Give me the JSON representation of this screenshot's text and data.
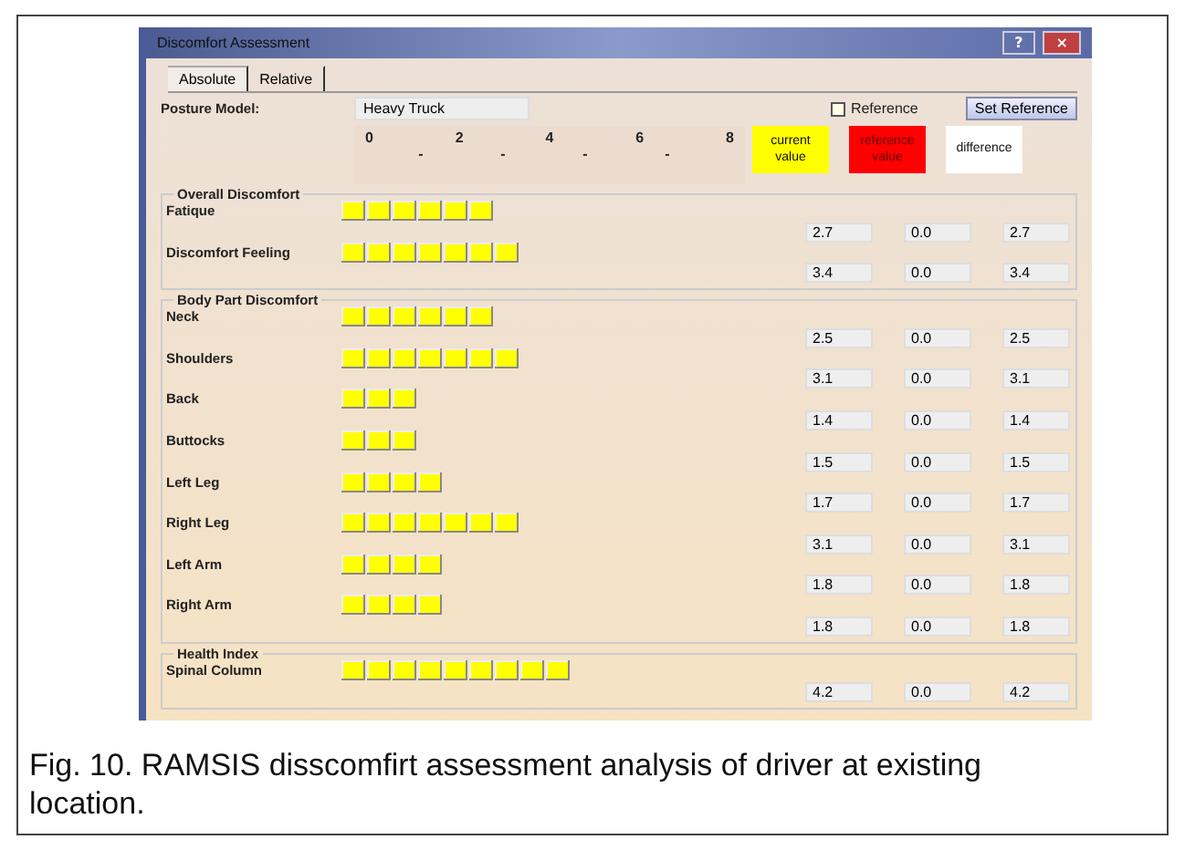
{
  "window": {
    "title": "Discomfort Assessment",
    "buttons": [
      "?",
      "×"
    ]
  },
  "tabs": [
    {
      "label": "Absolute",
      "selected": true
    },
    {
      "label": "Relative",
      "selected": false
    }
  ],
  "posture_model": {
    "label": "Posture Model:",
    "value": "Heavy Truck"
  },
  "reference": {
    "label": "Reference",
    "checked": false
  },
  "set_reference_button": "Set Reference",
  "scale": {
    "labels": [
      "0",
      "2",
      "4",
      "6",
      "8"
    ],
    "marks": [
      "-",
      "-",
      "-",
      "-"
    ]
  },
  "legend": [
    {
      "label": "current value",
      "color": "#ffff00"
    },
    {
      "label": "reference value",
      "color": "#ff0000"
    },
    {
      "label": "difference",
      "color": "#ffffff"
    }
  ],
  "groups": [
    {
      "title": "Overall Discomfort",
      "rows": [
        {
          "name": "Fatique",
          "stars": 6,
          "current": "2.7",
          "reference": "0.0",
          "difference": "2.7"
        },
        {
          "name": "Discomfort Feeling",
          "stars": 7,
          "current": "3.4",
          "reference": "0.0",
          "difference": "3.4"
        }
      ]
    },
    {
      "title": "Body Part Discomfort",
      "rows": [
        {
          "name": "Neck",
          "stars": 6,
          "current": "2.5",
          "reference": "0.0",
          "difference": "2.5"
        },
        {
          "name": "Shoulders",
          "stars": 7,
          "current": "3.1",
          "reference": "0.0",
          "difference": "3.1"
        },
        {
          "name": "Back",
          "stars": 3,
          "current": "1.4",
          "reference": "0.0",
          "difference": "1.4"
        },
        {
          "name": "Buttocks",
          "stars": 3,
          "current": "1.5",
          "reference": "0.0",
          "difference": "1.5"
        },
        {
          "name": "Left Leg",
          "stars": 4,
          "current": "1.7",
          "reference": "0.0",
          "difference": "1.7"
        },
        {
          "name": "Right Leg",
          "stars": 7,
          "current": "3.1",
          "reference": "0.0",
          "difference": "3.1"
        },
        {
          "name": "Left Arm",
          "stars": 4,
          "current": "1.8",
          "reference": "0.0",
          "difference": "1.8"
        },
        {
          "name": "Right Arm",
          "stars": 4,
          "current": "1.8",
          "reference": "0.0",
          "difference": "1.8"
        }
      ]
    },
    {
      "title": "Health Index",
      "rows": [
        {
          "name": "Spinal Column",
          "stars": 9,
          "current": "4.2",
          "reference": "0.0",
          "difference": "4.2"
        }
      ]
    }
  ],
  "caption": "Fig. 10. RAMSIS disscomfirt assessment analysis of driver at existing location."
}
